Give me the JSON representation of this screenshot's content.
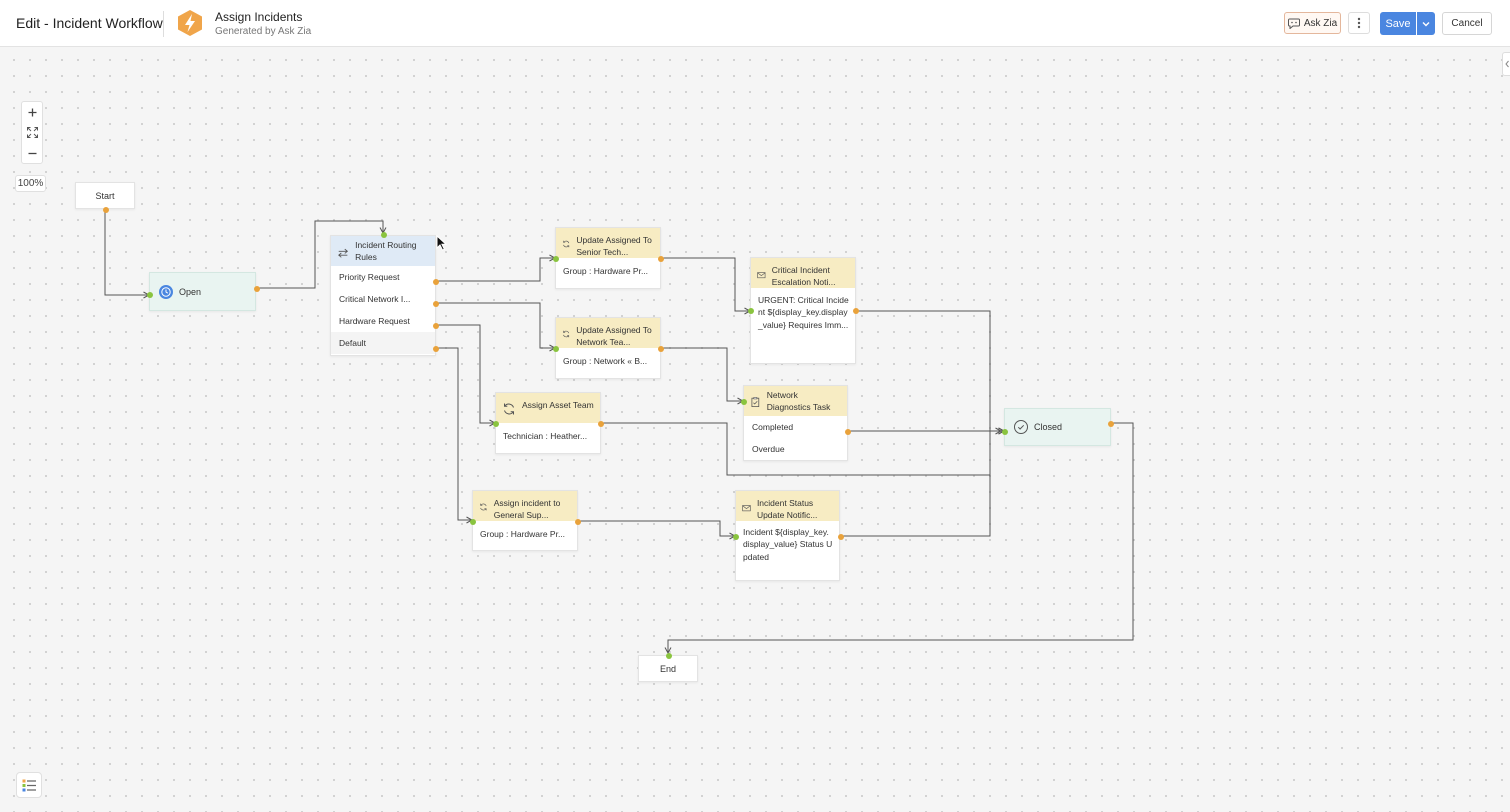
{
  "header": {
    "title": "Edit - Incident Workflow",
    "app_name": "Assign Incidents",
    "app_sub": "Generated by Ask Zia",
    "ask_zia": "Ask Zia",
    "save": "Save",
    "cancel": "Cancel"
  },
  "zoom": {
    "level": "100%"
  },
  "nodes": {
    "start": "Start",
    "end": "End",
    "open": "Open",
    "closed": "Closed",
    "routing": {
      "title": "Incident Routing Rules",
      "rules": [
        "Priority Request",
        "Critical Network I...",
        "Hardware Request",
        "Default"
      ]
    },
    "senior": {
      "title": "Update Assigned To Senior Tech...",
      "body": "Group : Hardware Pr..."
    },
    "network_team": {
      "title": "Update Assigned To Network Tea...",
      "body": "Group : Network « B..."
    },
    "asset": {
      "title": "Assign Asset Team",
      "body": "Technician : Heather..."
    },
    "general": {
      "title": "Assign incident to General Sup...",
      "body": "Group : Hardware Pr..."
    },
    "critical_notif": {
      "title": "Critical Incident Escalation Noti...",
      "body": "URGENT: Critical Incident ${display_key.display_value} Requires Imm..."
    },
    "diagnostics": {
      "title": "Network Diagnostics Task",
      "options": [
        "Completed",
        "Overdue"
      ]
    },
    "status_notif": {
      "title": "Incident Status Update Notific...",
      "body": "Incident ${display_key.display_value} Status Updated"
    }
  },
  "colors": {
    "accent": "#4a86e0",
    "state_bg": "#e9f4f1",
    "action_header": "#f7ecc3",
    "routing_header": "#dfeaf6",
    "port_in": "#8ac43f",
    "port_out": "#e9a23b"
  }
}
